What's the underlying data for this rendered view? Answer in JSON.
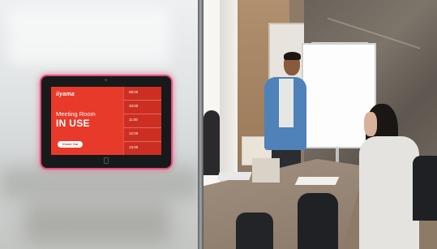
{
  "tablet": {
    "brand": "iiyama",
    "room_label": "Meeting Room",
    "status": "IN USE",
    "checkout_label": "Check Out",
    "time_slots": [
      "09:00",
      "10:00",
      "11:00",
      "12:00",
      "13:00"
    ]
  },
  "colors": {
    "screen_red": "#e83a2a",
    "led_glow": "#e0517c",
    "bezel": "#18191b"
  }
}
